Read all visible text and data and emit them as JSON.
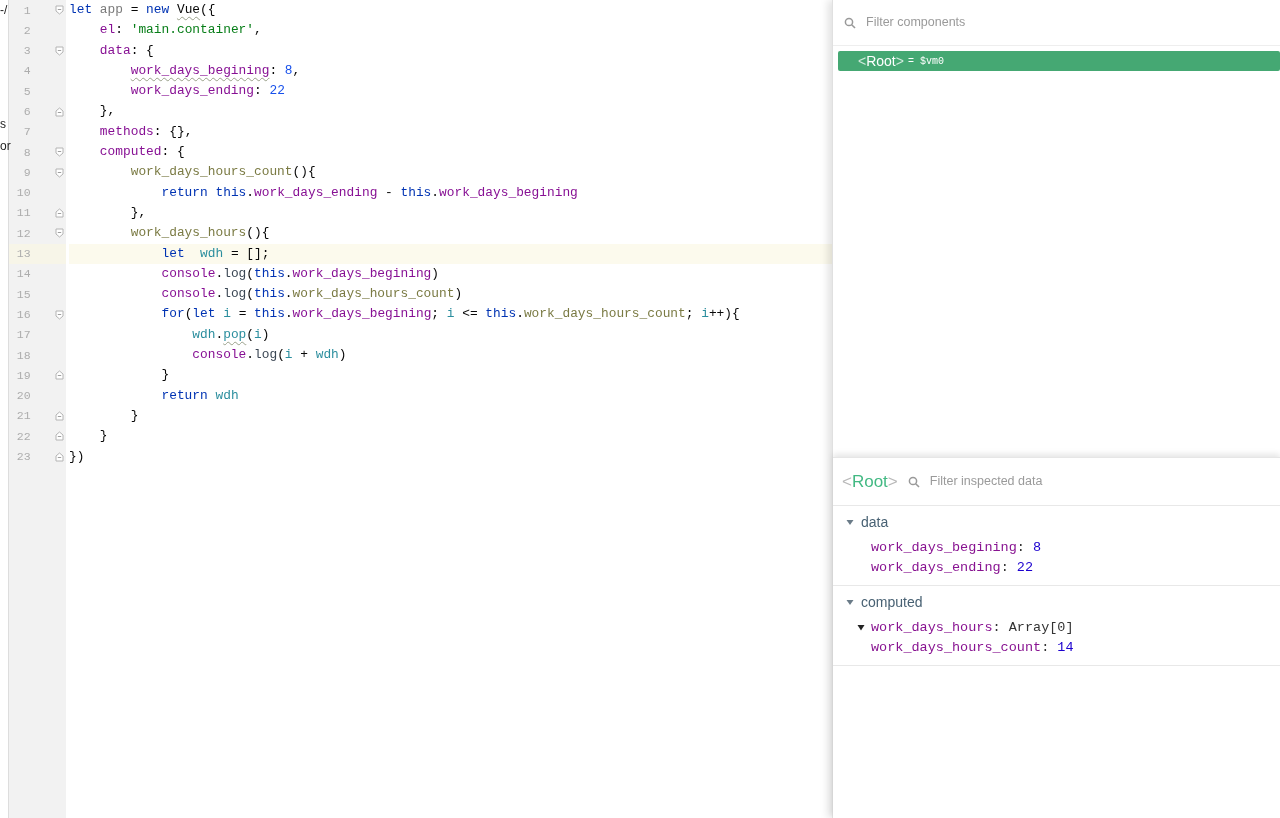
{
  "left_edge_fragments": [
    "-/",
    "s",
    "or"
  ],
  "editor": {
    "lines": [
      {
        "number": "1",
        "fold_marker": {
          "kind": "start"
        },
        "current": false,
        "tokens": [
          {
            "kind": "kw",
            "text": "let"
          },
          {
            "kind": "unused",
            "text": " app"
          },
          {
            "kind": "plain",
            "text": " = "
          },
          {
            "kind": "kw",
            "text": "new"
          },
          {
            "kind": "plain",
            "text": " Vue",
            "warning": true
          },
          {
            "kind": "plain",
            "text": "({"
          }
        ]
      },
      {
        "number": "2",
        "current": false,
        "tokens": [
          {
            "kind": "prop",
            "text": "    el"
          },
          {
            "kind": "plain",
            "text": ": "
          },
          {
            "kind": "str",
            "text": "'main.container'"
          },
          {
            "kind": "plain",
            "text": ","
          }
        ]
      },
      {
        "number": "3",
        "fold_marker": {
          "kind": "start"
        },
        "current": false,
        "tokens": [
          {
            "kind": "prop",
            "text": "    data"
          },
          {
            "kind": "plain",
            "text": ": {"
          }
        ]
      },
      {
        "number": "4",
        "current": false,
        "tokens": [
          {
            "kind": "prop",
            "text": "        work_days_begining",
            "warning": true
          },
          {
            "kind": "plain",
            "text": ": "
          },
          {
            "kind": "num",
            "text": "8"
          },
          {
            "kind": "plain",
            "text": ","
          }
        ]
      },
      {
        "number": "5",
        "current": false,
        "tokens": [
          {
            "kind": "prop",
            "text": "        work_days_ending"
          },
          {
            "kind": "plain",
            "text": ": "
          },
          {
            "kind": "num",
            "text": "22"
          }
        ]
      },
      {
        "number": "6",
        "fold_marker": {
          "kind": "end"
        },
        "current": false,
        "tokens": [
          {
            "kind": "plain",
            "text": "    },"
          }
        ]
      },
      {
        "number": "7",
        "current": false,
        "tokens": [
          {
            "kind": "prop",
            "text": "    methods"
          },
          {
            "kind": "plain",
            "text": ": {},"
          }
        ]
      },
      {
        "number": "8",
        "fold_marker": {
          "kind": "start"
        },
        "current": false,
        "tokens": [
          {
            "kind": "prop",
            "text": "    computed"
          },
          {
            "kind": "plain",
            "text": ": {"
          }
        ]
      },
      {
        "number": "9",
        "fold_marker": {
          "kind": "start"
        },
        "current": false,
        "tokens": [
          {
            "kind": "fn",
            "text": "        work_days_hours_count"
          },
          {
            "kind": "plain",
            "text": "(){"
          }
        ]
      },
      {
        "number": "10",
        "current": false,
        "tokens": [
          {
            "kind": "kw",
            "text": "            return"
          },
          {
            "kind": "kw",
            "text": " this"
          },
          {
            "kind": "plain",
            "text": "."
          },
          {
            "kind": "prop",
            "text": "work_days_ending"
          },
          {
            "kind": "plain",
            "text": " - "
          },
          {
            "kind": "kw",
            "text": "this"
          },
          {
            "kind": "plain",
            "text": "."
          },
          {
            "kind": "prop",
            "text": "work_days_begining"
          }
        ]
      },
      {
        "number": "11",
        "fold_marker": {
          "kind": "end"
        },
        "current": false,
        "tokens": [
          {
            "kind": "plain",
            "text": "        },"
          }
        ]
      },
      {
        "number": "12",
        "fold_marker": {
          "kind": "start"
        },
        "current": false,
        "tokens": [
          {
            "kind": "fn",
            "text": "        work_days_hours"
          },
          {
            "kind": "plain",
            "text": "(){"
          }
        ]
      },
      {
        "number": "13",
        "current": true,
        "tokens": [
          {
            "kind": "kw",
            "text": "            let"
          },
          {
            "kind": "var",
            "text": "  wdh"
          },
          {
            "kind": "plain",
            "text": " = [];"
          }
        ]
      },
      {
        "number": "14",
        "current": false,
        "tokens": [
          {
            "kind": "prop",
            "text": "            console"
          },
          {
            "kind": "plain",
            "text": "."
          },
          {
            "kind": "call",
            "text": "log"
          },
          {
            "kind": "plain",
            "text": "("
          },
          {
            "kind": "kw",
            "text": "this"
          },
          {
            "kind": "plain",
            "text": "."
          },
          {
            "kind": "prop",
            "text": "work_days_begining"
          },
          {
            "kind": "plain",
            "text": ")"
          }
        ]
      },
      {
        "number": "15",
        "current": false,
        "tokens": [
          {
            "kind": "prop",
            "text": "            console"
          },
          {
            "kind": "plain",
            "text": "."
          },
          {
            "kind": "call",
            "text": "log"
          },
          {
            "kind": "plain",
            "text": "("
          },
          {
            "kind": "kw",
            "text": "this"
          },
          {
            "kind": "plain",
            "text": "."
          },
          {
            "kind": "fn",
            "text": "work_days_hours_count"
          },
          {
            "kind": "plain",
            "text": ")"
          }
        ]
      },
      {
        "number": "16",
        "fold_marker": {
          "kind": "start"
        },
        "current": false,
        "tokens": [
          {
            "kind": "kw",
            "text": "            for"
          },
          {
            "kind": "plain",
            "text": "("
          },
          {
            "kind": "kw",
            "text": "let"
          },
          {
            "kind": "var",
            "text": " i"
          },
          {
            "kind": "plain",
            "text": " = "
          },
          {
            "kind": "kw",
            "text": "this"
          },
          {
            "kind": "plain",
            "text": "."
          },
          {
            "kind": "prop",
            "text": "work_days_begining"
          },
          {
            "kind": "plain",
            "text": "; "
          },
          {
            "kind": "var",
            "text": "i"
          },
          {
            "kind": "plain",
            "text": " <= "
          },
          {
            "kind": "kw",
            "text": "this"
          },
          {
            "kind": "plain",
            "text": "."
          },
          {
            "kind": "fn",
            "text": "work_days_hours_count"
          },
          {
            "kind": "plain",
            "text": "; "
          },
          {
            "kind": "var",
            "text": "i"
          },
          {
            "kind": "plain",
            "text": "++){"
          }
        ]
      },
      {
        "number": "17",
        "current": false,
        "tokens": [
          {
            "kind": "var",
            "text": "                wdh"
          },
          {
            "kind": "plain",
            "text": "."
          },
          {
            "kind": "var",
            "text": "pop",
            "warning": true
          },
          {
            "kind": "plain",
            "text": "("
          },
          {
            "kind": "var",
            "text": "i"
          },
          {
            "kind": "plain",
            "text": ")"
          }
        ]
      },
      {
        "number": "18",
        "current": false,
        "tokens": [
          {
            "kind": "prop",
            "text": "                console"
          },
          {
            "kind": "plain",
            "text": "."
          },
          {
            "kind": "call",
            "text": "log"
          },
          {
            "kind": "plain",
            "text": "("
          },
          {
            "kind": "var",
            "text": "i"
          },
          {
            "kind": "plain",
            "text": " + "
          },
          {
            "kind": "var",
            "text": "wdh"
          },
          {
            "kind": "plain",
            "text": ")"
          }
        ]
      },
      {
        "number": "19",
        "fold_marker": {
          "kind": "end"
        },
        "current": false,
        "tokens": [
          {
            "kind": "plain",
            "text": "            }"
          }
        ]
      },
      {
        "number": "20",
        "current": false,
        "tokens": [
          {
            "kind": "kw",
            "text": "            return"
          },
          {
            "kind": "var",
            "text": " wdh"
          }
        ]
      },
      {
        "number": "21",
        "fold_marker": {
          "kind": "end"
        },
        "current": false,
        "tokens": [
          {
            "kind": "plain",
            "text": "        }"
          }
        ]
      },
      {
        "number": "22",
        "fold_marker": {
          "kind": "end"
        },
        "current": false,
        "tokens": [
          {
            "kind": "plain",
            "text": "    }"
          }
        ]
      },
      {
        "number": "23",
        "fold_marker": {
          "kind": "end"
        },
        "current": false,
        "tokens": [
          {
            "kind": "plain",
            "text": "})"
          }
        ]
      }
    ]
  },
  "devtools": {
    "components": {
      "search": {
        "placeholder": "Filter components"
      },
      "tree": [
        {
          "bracket_open": "<",
          "name": "Root",
          "bracket_close": ">",
          "vm": "= $vm0",
          "selected": true
        }
      ]
    },
    "inspector": {
      "bracket_open": "<",
      "component": "Root",
      "bracket_close": ">",
      "search": {
        "placeholder": "Filter inspected data"
      },
      "sections": [
        {
          "title": "data",
          "expanded": true,
          "props": [
            {
              "key": "work_days_begining",
              "separator": ":",
              "value": "8",
              "kind": "leaf"
            },
            {
              "key": "work_days_ending",
              "separator": ":",
              "value": "22",
              "kind": "leaf"
            }
          ]
        },
        {
          "title": "computed",
          "expanded": true,
          "props": [
            {
              "key": "work_days_hours",
              "separator": ":",
              "value": "Array[0]",
              "kind": "expandable",
              "expanded": true
            },
            {
              "key": "work_days_hours_count",
              "separator": ":",
              "value": "14",
              "kind": "leaf"
            }
          ]
        }
      ]
    }
  }
}
